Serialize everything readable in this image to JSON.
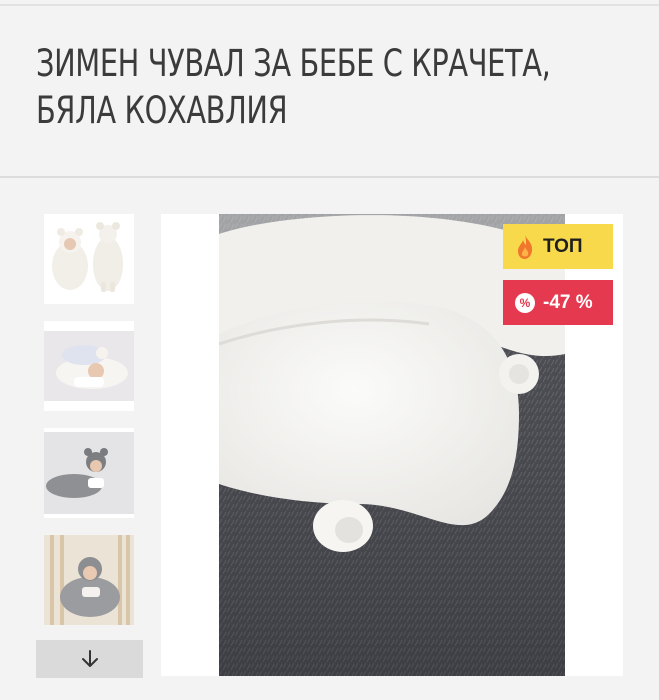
{
  "product": {
    "title_line1": "ЗИМЕН ЧУВАЛ ЗА БЕБЕ С КРАЧЕТА,",
    "title_line2": "БЯЛА КОХАВЛИЯ"
  },
  "gallery": {
    "thumbnails": [
      {
        "name": "white-bunting-front-back"
      },
      {
        "name": "baby-in-white-sack"
      },
      {
        "name": "baby-in-gray-sack"
      },
      {
        "name": "baby-in-crib-gray-sack"
      }
    ],
    "scroll_icon": "arrow-down-icon"
  },
  "badges": {
    "top_label": "ТОП",
    "top_icon": "fire-icon",
    "discount_label": "-47 %",
    "discount_icon": "percent-icon",
    "discount_symbol": "%"
  },
  "colors": {
    "badge_top": "#f8d94b",
    "badge_discount": "#e5394f",
    "background": "#f3f3f3"
  }
}
